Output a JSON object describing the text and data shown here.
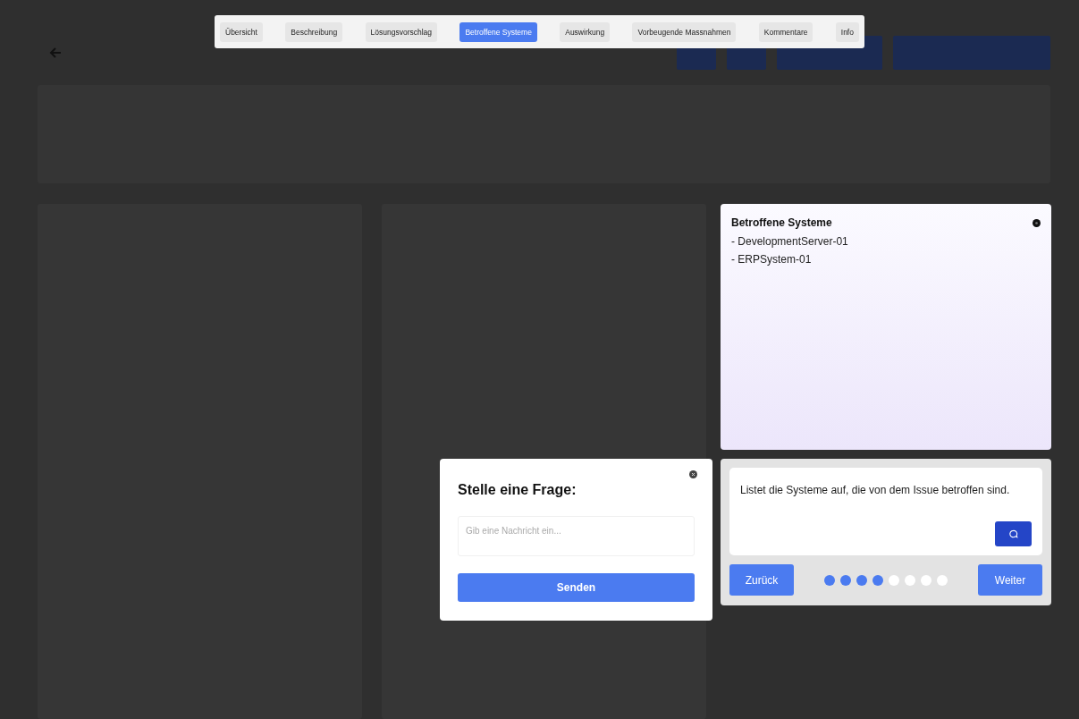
{
  "tabs": [
    {
      "label": "Übersicht",
      "selected": false
    },
    {
      "label": "Beschreibung",
      "selected": false
    },
    {
      "label": "Lösungsvorschlag",
      "selected": false
    },
    {
      "label": "Betroffene Systeme",
      "selected": true
    },
    {
      "label": "Auswirkung",
      "selected": false
    },
    {
      "label": "Vorbeugende Massnahmen",
      "selected": false
    },
    {
      "label": "Kommentare",
      "selected": false
    },
    {
      "label": "Info",
      "selected": false
    }
  ],
  "info_card": {
    "title": "Betroffene Systeme",
    "items": [
      "- DevelopmentServer-01",
      "- ERPSystem-01"
    ]
  },
  "guide": {
    "text": "Listet die Systeme auf, die von dem Issue betroffen sind.",
    "steps": [
      {
        "reached": true
      },
      {
        "reached": true
      },
      {
        "reached": true
      },
      {
        "reached": true
      },
      {
        "reached": false
      },
      {
        "reached": false
      },
      {
        "reached": false
      },
      {
        "reached": false
      }
    ],
    "back_label": "Zurück",
    "next_label": "Weiter"
  },
  "question_dialog": {
    "title": "Stelle eine Frage:",
    "placeholder": "Gib eine Nachricht ein...",
    "send_label": "Senden"
  }
}
